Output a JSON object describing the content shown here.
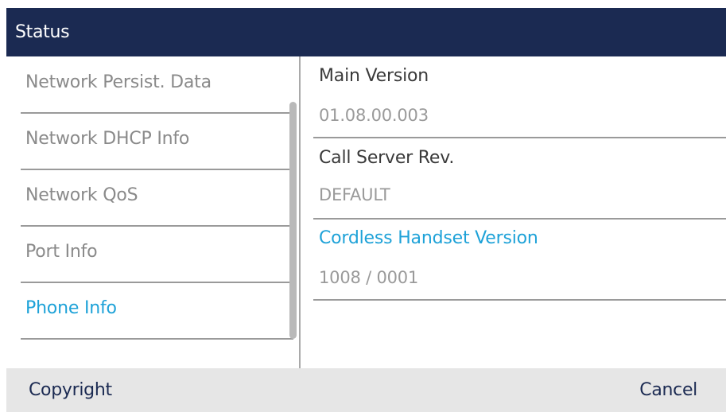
{
  "header": {
    "title": "Status"
  },
  "menu": {
    "items": [
      {
        "label": "Network Persist. Data",
        "active": false
      },
      {
        "label": "Network DHCP Info",
        "active": false
      },
      {
        "label": "Network QoS",
        "active": false
      },
      {
        "label": "Port Info",
        "active": false
      },
      {
        "label": "Phone Info",
        "active": true
      }
    ]
  },
  "details": {
    "fields": [
      {
        "label": "Main Version",
        "value": "01.08.00.003",
        "active": false
      },
      {
        "label": "Call Server Rev.",
        "value": "DEFAULT",
        "active": false
      },
      {
        "label": "Cordless Handset Version",
        "value": "1008 / 0001",
        "active": true
      }
    ]
  },
  "softkeys": {
    "left": "Copyright",
    "right": "Cancel"
  },
  "colors": {
    "title_bar": "#1b2a52",
    "accent": "#1ea2d8",
    "inactive_text": "#8a8a8a",
    "softkey_bar": "#e6e6e6"
  }
}
